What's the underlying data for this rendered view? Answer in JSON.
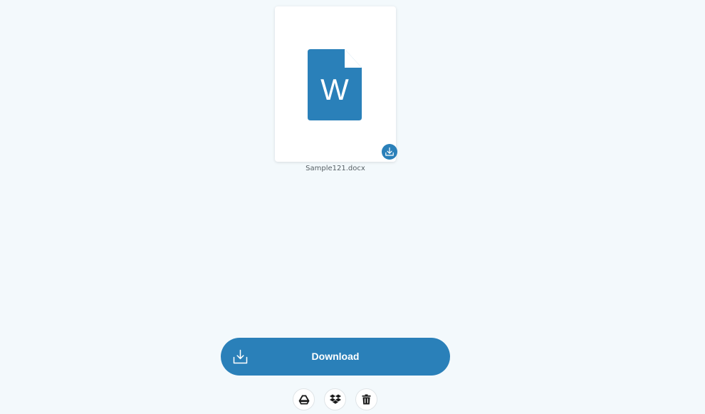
{
  "file": {
    "name": "Sample121.docx",
    "type_icon": "word-document-icon",
    "badge_icon": "download-icon"
  },
  "download_button": {
    "label": "Download",
    "icon": "download-tray-icon"
  },
  "actions": [
    {
      "icon": "google-drive-icon"
    },
    {
      "icon": "dropbox-icon"
    },
    {
      "icon": "trash-icon"
    }
  ],
  "colors": {
    "background": "#f3f9fc",
    "accent": "#2a80b9",
    "card": "#ffffff"
  }
}
